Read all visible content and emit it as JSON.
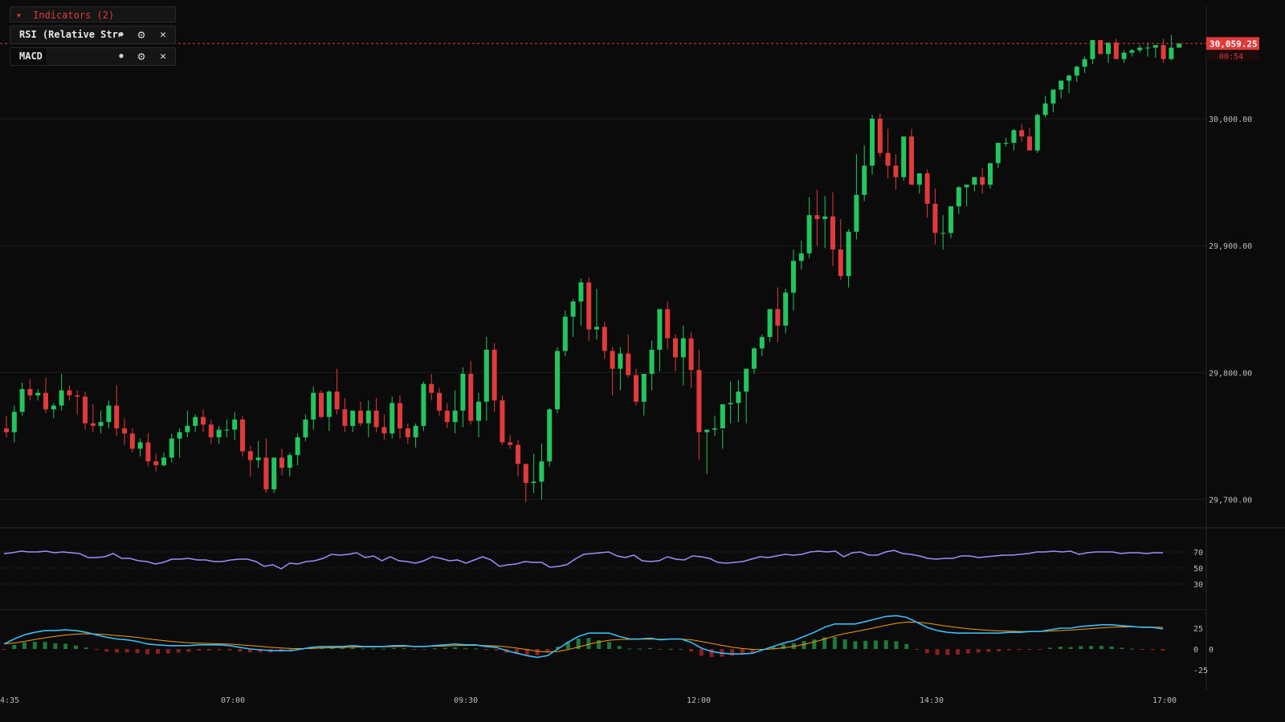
{
  "indicators_panel": {
    "header_label": "Indicators (2)",
    "items": [
      {
        "label": "RSI (Relative Strength Index)"
      },
      {
        "label": "MACD"
      }
    ]
  },
  "colors": {
    "background": "#0b0b0b",
    "up": "#22c55e",
    "down": "#e03a3a",
    "rsi_line": "#a78bfa",
    "macd_line": "#38bdf8",
    "signal_line": "#f59e0b",
    "hist_up": "#1f7a3a",
    "hist_down": "#8b2020",
    "grid": "#1c1c1c",
    "text": "#bdbdbd"
  },
  "chart_data": {
    "type": "candlestick",
    "price_axis": {
      "ticks": [
        "30,000.00",
        "29,900.00",
        "29,800.00",
        "29,700.00"
      ],
      "ylim": [
        29682,
        30092
      ]
    },
    "time_axis": {
      "ticks": [
        "4:35",
        "07:00",
        "09:30",
        "12:00",
        "14:30",
        "17:00"
      ]
    },
    "last_price": {
      "value": "30,059.25",
      "countdown": "00:54"
    },
    "candles": [
      [
        29756,
        29766,
        29749,
        29753
      ],
      [
        29753,
        29774,
        29745,
        29769
      ],
      [
        29769,
        29792,
        29766,
        29787
      ],
      [
        29787,
        29795,
        29778,
        29782
      ],
      [
        29782,
        29787,
        29778,
        29784
      ],
      [
        29784,
        29796,
        29768,
        29771
      ],
      [
        29771,
        29776,
        29764,
        29774
      ],
      [
        29774,
        29799,
        29770,
        29786
      ],
      [
        29786,
        29790,
        29778,
        29782
      ],
      [
        29782,
        29786,
        29767,
        29781
      ],
      [
        29781,
        29785,
        29755,
        29760
      ],
      [
        29760,
        29775,
        29753,
        29758
      ],
      [
        29758,
        29770,
        29752,
        29761
      ],
      [
        29761,
        29778,
        29756,
        29774
      ],
      [
        29774,
        29790,
        29750,
        29756
      ],
      [
        29756,
        29764,
        29743,
        29752
      ],
      [
        29752,
        29756,
        29737,
        29740
      ],
      [
        29740,
        29748,
        29734,
        29745
      ],
      [
        29745,
        29752,
        29726,
        29730
      ],
      [
        29730,
        29736,
        29722,
        29727
      ],
      [
        29727,
        29737,
        29726,
        29733
      ],
      [
        29733,
        29752,
        29729,
        29748
      ],
      [
        29748,
        29756,
        29733,
        29753
      ],
      [
        29753,
        29770,
        29749,
        29758
      ],
      [
        29758,
        29767,
        29753,
        29765
      ],
      [
        29765,
        29771,
        29753,
        29759
      ],
      [
        29759,
        29763,
        29744,
        29749
      ],
      [
        29749,
        29758,
        29744,
        29755
      ],
      [
        29755,
        29763,
        29749,
        29755
      ],
      [
        29755,
        29769,
        29747,
        29763
      ],
      [
        29763,
        29766,
        29734,
        29738
      ],
      [
        29738,
        29742,
        29718,
        29731
      ],
      [
        29731,
        29746,
        29725,
        29733
      ],
      [
        29733,
        29748,
        29705,
        29708
      ],
      [
        29708,
        29731,
        29705,
        29733
      ],
      [
        29733,
        29740,
        29719,
        29725
      ],
      [
        29725,
        29737,
        29718,
        29735
      ],
      [
        29735,
        29752,
        29727,
        29749
      ],
      [
        29749,
        29767,
        29746,
        29763
      ],
      [
        29763,
        29789,
        29755,
        29784
      ],
      [
        29784,
        29786,
        29764,
        29765
      ],
      [
        29765,
        29786,
        29754,
        29785
      ],
      [
        29785,
        29803,
        29767,
        29771
      ],
      [
        29771,
        29780,
        29753,
        29758
      ],
      [
        29758,
        29770,
        29753,
        29770
      ],
      [
        29770,
        29777,
        29758,
        29760
      ],
      [
        29760,
        29778,
        29749,
        29770
      ],
      [
        29770,
        29780,
        29753,
        29757
      ],
      [
        29757,
        29767,
        29747,
        29752
      ],
      [
        29752,
        29781,
        29748,
        29776
      ],
      [
        29776,
        29782,
        29748,
        29756
      ],
      [
        29756,
        29760,
        29744,
        29749
      ],
      [
        29749,
        29760,
        29741,
        29758
      ],
      [
        29758,
        29793,
        29754,
        29791
      ],
      [
        29791,
        29799,
        29778,
        29784
      ],
      [
        29784,
        29788,
        29766,
        29770
      ],
      [
        29770,
        29776,
        29756,
        29761
      ],
      [
        29761,
        29786,
        29752,
        29770
      ],
      [
        29770,
        29804,
        29757,
        29799
      ],
      [
        29799,
        29809,
        29759,
        29762
      ],
      [
        29762,
        29784,
        29749,
        29777
      ],
      [
        29777,
        29828,
        29762,
        29818
      ],
      [
        29818,
        29823,
        29769,
        29778
      ],
      [
        29778,
        29782,
        29743,
        29745
      ],
      [
        29745,
        29751,
        29740,
        29743
      ],
      [
        29743,
        29747,
        29718,
        29728
      ],
      [
        29728,
        29728,
        29698,
        29713
      ],
      [
        29713,
        29736,
        29705,
        29714
      ],
      [
        29714,
        29744,
        29700,
        29730
      ],
      [
        29730,
        29772,
        29726,
        29771
      ],
      [
        29771,
        29820,
        29768,
        29817
      ],
      [
        29817,
        29849,
        29813,
        29844
      ],
      [
        29844,
        29858,
        29828,
        29856
      ],
      [
        29856,
        29874,
        29837,
        29871
      ],
      [
        29871,
        29875,
        29825,
        29834
      ],
      [
        29834,
        29866,
        29826,
        29836
      ],
      [
        29836,
        29840,
        29811,
        29817
      ],
      [
        29817,
        29820,
        29782,
        29803
      ],
      [
        29803,
        29820,
        29786,
        29815
      ],
      [
        29815,
        29830,
        29796,
        29798
      ],
      [
        29798,
        29803,
        29774,
        29777
      ],
      [
        29777,
        29795,
        29766,
        29799
      ],
      [
        29799,
        29825,
        29786,
        29818
      ],
      [
        29818,
        29848,
        29801,
        29850
      ],
      [
        29850,
        29856,
        29818,
        29827
      ],
      [
        29827,
        29830,
        29801,
        29812
      ],
      [
        29812,
        29837,
        29790,
        29827
      ],
      [
        29827,
        29832,
        29788,
        29802
      ],
      [
        29802,
        29818,
        29731,
        29753
      ],
      [
        29753,
        29753,
        29720,
        29755
      ],
      [
        29755,
        29766,
        29750,
        29756
      ],
      [
        29756,
        29755,
        29740,
        29775
      ],
      [
        29775,
        29793,
        29760,
        29776
      ],
      [
        29776,
        29794,
        29761,
        29785
      ],
      [
        29785,
        29801,
        29760,
        29803
      ],
      [
        29803,
        29820,
        29799,
        29819
      ],
      [
        29819,
        29830,
        29813,
        29828
      ],
      [
        29828,
        29846,
        29824,
        29850
      ],
      [
        29850,
        29867,
        29824,
        29837
      ],
      [
        29837,
        29866,
        29831,
        29863
      ],
      [
        29863,
        29897,
        29849,
        29888
      ],
      [
        29888,
        29904,
        29881,
        29894
      ],
      [
        29894,
        29938,
        29890,
        29924
      ],
      [
        29924,
        29944,
        29900,
        29921
      ],
      [
        29921,
        29939,
        29898,
        29923
      ],
      [
        29923,
        29942,
        29884,
        29897
      ],
      [
        29897,
        29921,
        29873,
        29876
      ],
      [
        29876,
        29913,
        29867,
        29911
      ],
      [
        29911,
        29972,
        29905,
        29940
      ],
      [
        29940,
        29979,
        29935,
        29963
      ],
      [
        29963,
        30003,
        29956,
        30000
      ],
      [
        30000,
        30004,
        29970,
        29973
      ],
      [
        29973,
        29992,
        29953,
        29963
      ],
      [
        29963,
        29972,
        29944,
        29954
      ],
      [
        29954,
        29986,
        29951,
        29986
      ],
      [
        29986,
        29992,
        29949,
        29948
      ],
      [
        29948,
        29954,
        29941,
        29957
      ],
      [
        29957,
        29960,
        29922,
        29933
      ],
      [
        29933,
        29945,
        29901,
        29910
      ],
      [
        29910,
        29924,
        29897,
        29910
      ],
      [
        29910,
        29931,
        29906,
        29931
      ],
      [
        29931,
        29947,
        29925,
        29946
      ],
      [
        29946,
        29948,
        29931,
        29948
      ],
      [
        29948,
        29954,
        29943,
        29954
      ],
      [
        29954,
        29961,
        29941,
        29948
      ],
      [
        29948,
        29965,
        29945,
        29965
      ],
      [
        29965,
        29980,
        29961,
        29981
      ],
      [
        29981,
        29985,
        29978,
        29981
      ],
      [
        29981,
        29992,
        29975,
        29991
      ],
      [
        29991,
        29996,
        29982,
        29986
      ],
      [
        29986,
        29993,
        29976,
        29975
      ],
      [
        29975,
        30004,
        29973,
        30003
      ],
      [
        30003,
        30018,
        30001,
        30012
      ],
      [
        30012,
        30022,
        30005,
        30023
      ],
      [
        30023,
        30024,
        30016,
        30030
      ],
      [
        30030,
        30035,
        30020,
        30034
      ],
      [
        30034,
        30042,
        30029,
        30041
      ],
      [
        30041,
        30049,
        30036,
        30047
      ],
      [
        30047,
        30059,
        30043,
        30062
      ],
      [
        30062,
        30058,
        30051,
        30051
      ],
      [
        30051,
        30060,
        30044,
        30060
      ],
      [
        30060,
        30063,
        30047,
        30047
      ],
      [
        30047,
        30054,
        30044,
        30052
      ],
      [
        30052,
        30055,
        30049,
        30054
      ],
      [
        30054,
        30058,
        30052,
        30056
      ],
      [
        30056,
        30060,
        30049,
        30056
      ],
      [
        30056,
        30058,
        30048,
        30058
      ],
      [
        30058,
        30063,
        30044,
        30047
      ],
      [
        30047,
        30066,
        30046,
        30056
      ],
      [
        30056,
        30060,
        30058,
        30059
      ]
    ],
    "rsi": {
      "levels": [
        70,
        50,
        30
      ],
      "values": [
        68,
        69,
        71,
        70,
        70,
        71,
        69,
        70,
        69,
        68,
        63,
        63,
        64,
        68,
        62,
        62,
        59,
        58,
        55,
        57,
        61,
        61,
        62,
        60,
        60,
        58,
        58,
        60,
        61,
        61,
        58,
        52,
        54,
        49,
        56,
        55,
        58,
        59,
        62,
        67,
        66,
        67,
        69,
        63,
        65,
        59,
        64,
        59,
        58,
        56,
        59,
        64,
        62,
        59,
        60,
        56,
        60,
        64,
        60,
        52,
        54,
        55,
        58,
        57,
        57,
        51,
        52,
        54,
        61,
        67,
        68,
        69,
        70,
        65,
        63,
        66,
        59,
        58,
        59,
        64,
        61,
        60,
        65,
        64,
        62,
        57,
        56,
        57,
        58,
        61,
        64,
        63,
        65,
        67,
        66,
        67,
        70,
        71,
        70,
        71,
        64,
        69,
        70,
        66,
        66,
        70,
        72,
        68,
        67,
        65,
        62,
        61,
        62,
        62,
        65,
        65,
        63,
        64,
        65,
        66,
        66,
        67,
        68,
        70,
        70,
        71,
        70,
        71,
        67,
        69,
        70,
        70,
        70,
        68,
        69,
        69,
        68,
        69,
        69
      ]
    },
    "macd": {
      "ticks": [
        "25",
        "0",
        "-25"
      ],
      "macd": [
        6,
        12,
        17,
        20,
        22,
        22,
        23,
        22,
        20,
        17,
        14,
        12,
        11,
        9,
        6,
        5,
        4,
        4,
        4,
        5,
        5,
        5,
        4,
        2,
        0,
        -1,
        -2,
        -2,
        -2,
        0,
        2,
        3,
        3,
        3,
        4,
        3,
        3,
        3,
        4,
        4,
        3,
        3,
        4,
        5,
        6,
        5,
        5,
        3,
        2,
        -2,
        -5,
        -8,
        -10,
        -8,
        0,
        8,
        15,
        19,
        19,
        19,
        15,
        12,
        12,
        13,
        11,
        12,
        12,
        8,
        1,
        -3,
        -5,
        -6,
        -6,
        -5,
        -1,
        3,
        7,
        10,
        15,
        20,
        26,
        30,
        30,
        30,
        33,
        36,
        39,
        40,
        38,
        32,
        26,
        22,
        20,
        19,
        19,
        19,
        19,
        19,
        20,
        20,
        21,
        21,
        23,
        25,
        25,
        27,
        28,
        29,
        29,
        28,
        27,
        26,
        26,
        24
      ]
    }
  }
}
